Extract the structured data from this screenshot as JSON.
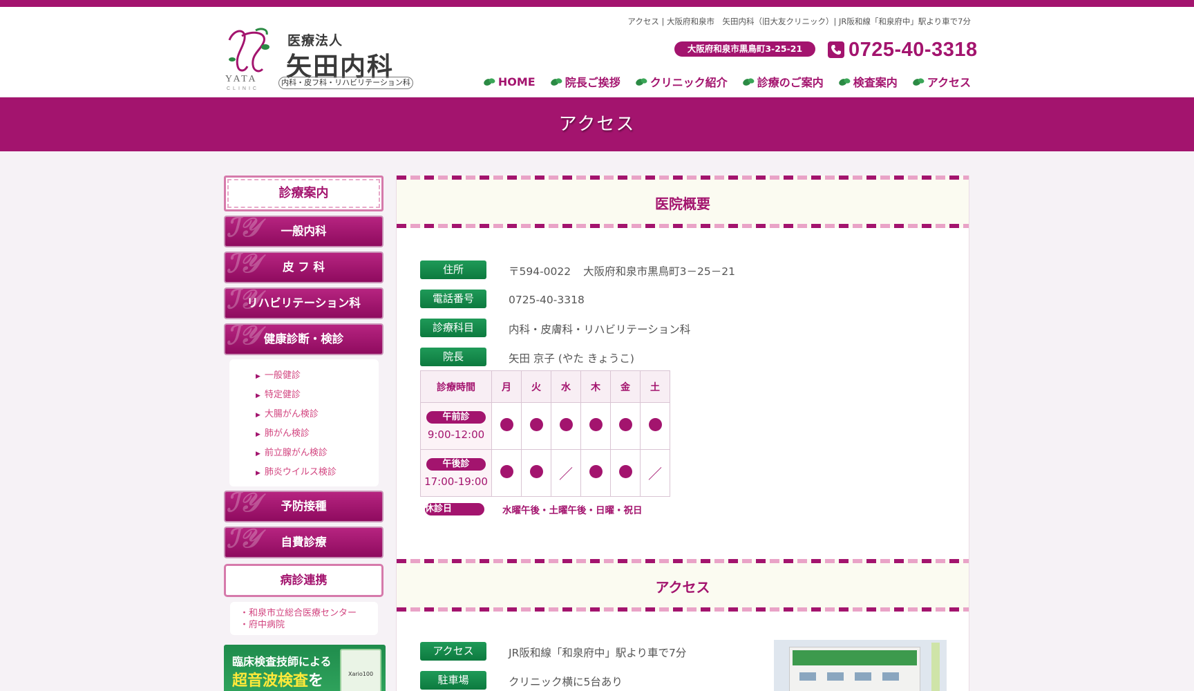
{
  "header": {
    "tagline": "アクセス | 大阪府和泉市　矢田内科（旧大友クリニック）| JR阪和線「和泉府中」駅より車で7分",
    "logo_mark_name": "YATA CLINIC",
    "logo_corp": "医療法人",
    "logo_name": "矢田内科",
    "logo_sub": "内科・皮フ科・リハビリテーション科",
    "address_pill": "大阪府和泉市黒鳥町3-25-21",
    "phone": "0725-40-3318"
  },
  "nav": [
    {
      "label": "HOME",
      "icon": "leaf-icon"
    },
    {
      "label": "院長ご挨拶",
      "icon": "leaf-icon"
    },
    {
      "label": "クリニック紹介",
      "icon": "leaf-icon"
    },
    {
      "label": "診療のご案内",
      "icon": "leaf-icon"
    },
    {
      "label": "検査案内",
      "icon": "leaf-icon"
    },
    {
      "label": "アクセス",
      "icon": "leaf-icon"
    }
  ],
  "page_title": "アクセス",
  "sidebar": {
    "heading": "診療案内",
    "buttons": [
      "一般内科",
      "皮 フ 科",
      "リハビリテーション科",
      "健康診断・検診"
    ],
    "checkup_items": [
      "一般健診",
      "特定健診",
      "大腸がん検診",
      "肺がん検診",
      "前立腺がん検診",
      "肺炎ウイルス検診"
    ],
    "buttons2": [
      "予防接種",
      "自費診療"
    ],
    "partner_heading": "病診連携",
    "partner_links": [
      "・和泉市立総合医療センター",
      "・府中病院"
    ],
    "banner": {
      "line1": "臨床検査技師による",
      "line2_main": "超音波検査",
      "line2_tail": "を",
      "device_label": "Xario100"
    }
  },
  "overview": {
    "title": "医院概要",
    "rows": [
      {
        "label": "住所",
        "value_postal": "〒594-0022",
        "value": "大阪府和泉市黒鳥町3－25－21"
      },
      {
        "label": "電話番号",
        "value": "0725-40-3318"
      },
      {
        "label": "診療科目",
        "value": "内科・皮膚科・リハビリテーション科"
      },
      {
        "label": "院長",
        "value": "矢田 京子 (やた きょうこ)"
      }
    ]
  },
  "schedule": {
    "time_header": "診療時間",
    "days": [
      "月",
      "火",
      "水",
      "木",
      "金",
      "土"
    ],
    "rows": [
      {
        "label": "午前診",
        "hours": "9:00-12:00",
        "marks": [
          "●",
          "●",
          "●",
          "●",
          "●",
          "●"
        ]
      },
      {
        "label": "午後診",
        "hours": "17:00-19:00",
        "marks": [
          "●",
          "●",
          "／",
          "●",
          "●",
          "／"
        ]
      }
    ],
    "closed_label": "休診日",
    "closed_text": "水曜午後・土曜午後・日曜・祝日"
  },
  "access": {
    "title": "アクセス",
    "rows": [
      {
        "label": "アクセス",
        "value": "JR阪和線「和泉府中」駅より車で7分"
      },
      {
        "label": "駐車場",
        "value": "クリニック横に5台あり"
      }
    ]
  },
  "colors": {
    "brand": "#a3146e",
    "accent_green": "#0d7a3f",
    "pink_light": "#e9a3c7"
  }
}
